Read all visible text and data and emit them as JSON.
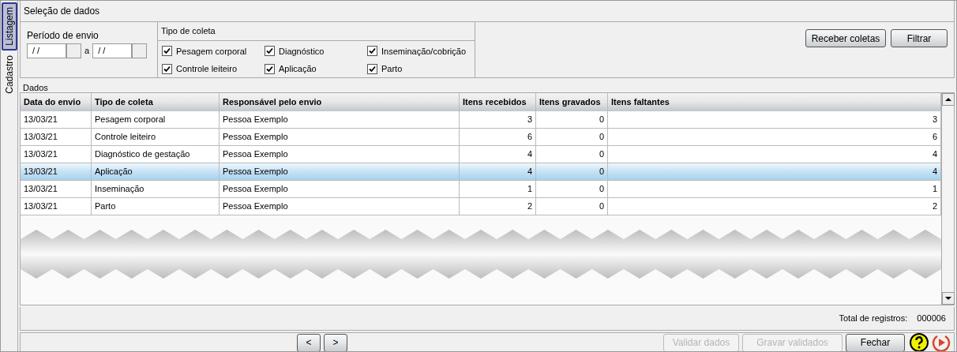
{
  "side_tabs": [
    {
      "label": "Listagem",
      "selected": true
    },
    {
      "label": "Cadastro",
      "selected": false
    }
  ],
  "selection": {
    "title": "Seleção de dados",
    "period": {
      "label": "Período de envio",
      "from": "/ /",
      "separator": "a",
      "to": "/ /"
    },
    "types": {
      "title": "Tipo de coleta",
      "options": [
        {
          "label": "Pesagem corporal",
          "checked": true
        },
        {
          "label": "Diagnóstico",
          "checked": true
        },
        {
          "label": "Inseminação/cobrição",
          "checked": true
        },
        {
          "label": "Controle leiteiro",
          "checked": true
        },
        {
          "label": "Aplicação",
          "checked": true
        },
        {
          "label": "Parto",
          "checked": true
        }
      ]
    },
    "buttons": [
      "Receber coletas",
      "Filtrar"
    ]
  },
  "data": {
    "title": "Dados",
    "columns": [
      "Data do envio",
      "Tipo de coleta",
      "Responsável pelo envio",
      "Itens recebidos",
      "Itens gravados",
      "Itens faltantes"
    ],
    "rows": [
      {
        "cells": [
          "13/03/21",
          "Pesagem corporal",
          "Pessoa Exemplo",
          "3",
          "0",
          "3"
        ],
        "selected": false
      },
      {
        "cells": [
          "13/03/21",
          "Controle leiteiro",
          "Pessoa Exemplo",
          "6",
          "0",
          "6"
        ],
        "selected": false
      },
      {
        "cells": [
          "13/03/21",
          "Diagnóstico de gestação",
          "Pessoa Exemplo",
          "4",
          "0",
          "4"
        ],
        "selected": false
      },
      {
        "cells": [
          "13/03/21",
          "Aplicação",
          "Pessoa Exemplo",
          "4",
          "0",
          "4"
        ],
        "selected": true
      },
      {
        "cells": [
          "13/03/21",
          "Inseminação",
          "Pessoa Exemplo",
          "1",
          "0",
          "1"
        ],
        "selected": false
      },
      {
        "cells": [
          "13/03/21",
          "Parto",
          "Pessoa Exemplo",
          "2",
          "0",
          "2"
        ],
        "selected": false
      }
    ],
    "total_label": "Total de registros:",
    "total_value": "000006"
  },
  "footer": {
    "nav": [
      "<",
      ">"
    ],
    "buttons": [
      {
        "label": "Validar dados",
        "disabled": true
      },
      {
        "label": "Gravar validados",
        "disabled": true
      },
      {
        "label": "Fechar",
        "disabled": false
      }
    ]
  }
}
